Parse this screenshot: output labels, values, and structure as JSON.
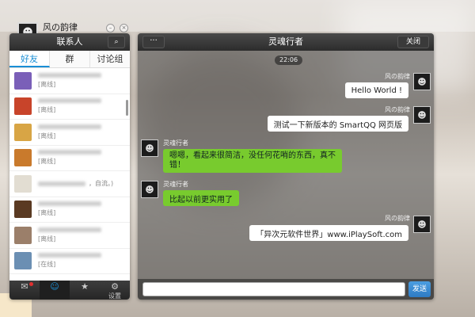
{
  "profile": {
    "name": "风の韵律"
  },
  "contacts_panel": {
    "title": "联系人",
    "tabs": [
      {
        "label": "好友",
        "active": true
      },
      {
        "label": "群",
        "active": false
      },
      {
        "label": "讨论组",
        "active": false
      }
    ],
    "contacts": [
      {
        "status": "[离线]",
        "color": "#7a5fb8"
      },
      {
        "status": "[离线]",
        "color": "#c8442a"
      },
      {
        "status": "[离线]",
        "color": "#d8a545"
      },
      {
        "status": "[离线]",
        "color": "#c97a2c"
      },
      {
        "status": "",
        "color": "#e2ddd2"
      },
      {
        "status": "[离线]",
        "color": "#5a3a22"
      },
      {
        "status": "[离线]",
        "color": "#9b7f6a"
      },
      {
        "status": "[在线]",
        "color": "#6b8fb3"
      }
    ],
    "contact_extra_text": "，自流。)",
    "bottom_nav": [
      {
        "icon": "chat-icon",
        "label": ""
      },
      {
        "icon": "contacts-icon",
        "label": ""
      },
      {
        "icon": "star-icon",
        "label": ""
      },
      {
        "icon": "settings-icon",
        "label": "设置"
      }
    ]
  },
  "chat": {
    "title": "灵魂行者",
    "more_label": "···",
    "close_label": "关闭",
    "time": "22:06",
    "messages": [
      {
        "sender": "风の韵律",
        "side": "right",
        "text": "Hello World !"
      },
      {
        "sender": "风の韵律",
        "side": "right",
        "text": "测试一下新版本的 SmartQQ 网页版"
      },
      {
        "sender": "灵魂行者",
        "side": "left",
        "line1": "嗯嗯，看起来很简洁，没任何花哨的东西，真不",
        "line2": "错！"
      },
      {
        "sender": "灵魂行者",
        "side": "left",
        "text": "比起以前更实用了"
      },
      {
        "sender": "风の韵律",
        "side": "right",
        "text": "「异次元软件世界」www.iPlaySoft.com"
      }
    ],
    "send_label": "发送"
  }
}
